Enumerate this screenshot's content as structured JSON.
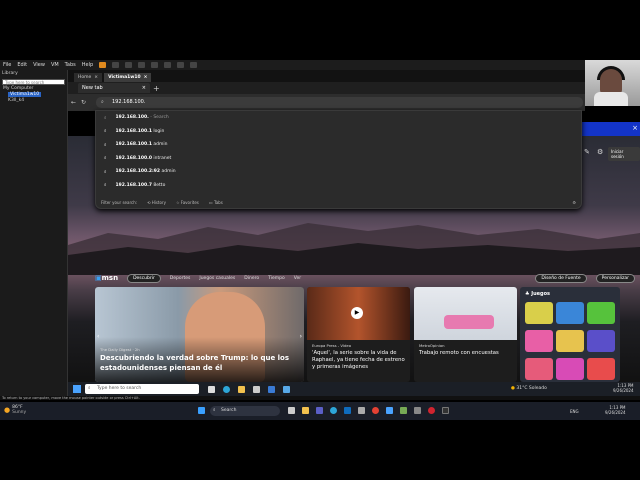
{
  "vm": {
    "menu": [
      "File",
      "Edit",
      "View",
      "VM",
      "Tabs",
      "Help"
    ],
    "library_title": "Library",
    "library_search_placeholder": "Type here to search",
    "tree": {
      "root": "My Computer",
      "item1": "Victima1w10",
      "item2": "K3lI_k4"
    },
    "tabs": [
      "Home",
      "Victima1w10"
    ],
    "status": "To return to your computer, move the mouse pointer outside or press Ctrl+Alt."
  },
  "edge": {
    "tab_title": "New tab",
    "address_value": "192.168.100.",
    "suggestions": [
      {
        "bold": "192.168.100.",
        "rest": " - Search"
      },
      {
        "bold": "192.168.100.1",
        "rest": " login"
      },
      {
        "bold": "192.168.100.1",
        "rest": " admin"
      },
      {
        "bold": "192.168.100.0",
        "rest": " intranet"
      },
      {
        "bold": "192.168.100.2:92",
        "rest": " admin"
      },
      {
        "bold": "192.168.100.7",
        "rest": " 8etto"
      }
    ],
    "filter_label": "Filter your search:",
    "filters": [
      "History",
      "Favorites",
      "Tabs"
    ],
    "signin": "Iniciar sesión"
  },
  "msn": {
    "logo": "msn",
    "nav": [
      "Descubrir",
      "Deportes",
      "Juegos casuales",
      "Dinero",
      "Tiempo",
      "Ver"
    ],
    "btn_theme": "Diseño de Fuente",
    "btn_personalize": "Personalizar",
    "main_source": "The Daily Digest · 2h",
    "main_title": "Descubriendo la verdad sobre Trump: lo que los estadounidenses piensan de él",
    "card2_source": "Europa Press - Vídeo",
    "card2_title": "'Aquel', la serie sobre la vida de Raphael, ya tiene fecha de estreno y primeras imágenes",
    "card3_source": "MetroOpinion",
    "card3_title": "Trabajo remoto con encuestas",
    "games_title": "Juegos",
    "game_colors": [
      "#d9cf4a",
      "#3a86d8",
      "#56c23c",
      "#e85fa6",
      "#e7c34e",
      "#5a4fc9",
      "#e65b7a",
      "#d84bb6",
      "#e84c4c"
    ]
  },
  "guest_taskbar": {
    "search_placeholder": "Type here to search",
    "weather": "31°C Soleado",
    "time": "1:13 PM",
    "date": "9/26/2024"
  },
  "host_taskbar": {
    "weather_temp": "86°F",
    "weather_desc": "Sunny",
    "search": "Search",
    "lang": "ENG",
    "time": "1:13 PM",
    "date": "9/26/2024"
  },
  "colors": {
    "accent": "#1334c8",
    "sunset": "#8a6475"
  }
}
